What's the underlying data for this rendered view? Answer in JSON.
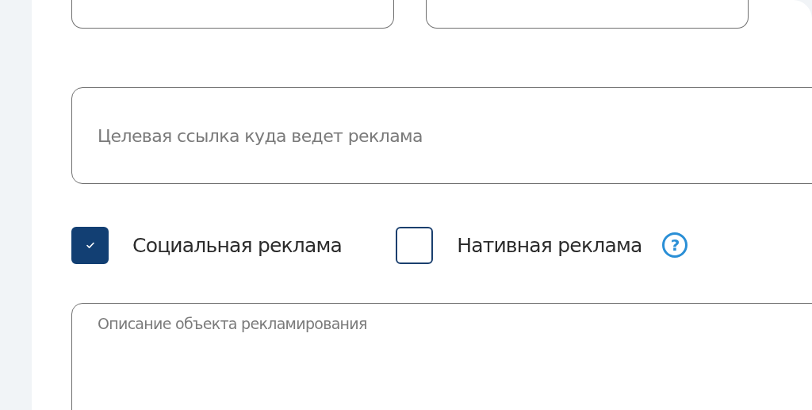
{
  "top_fields": [
    {
      "kind": "text"
    },
    {
      "kind": "text"
    }
  ],
  "link_field": {
    "placeholder": "Целевая ссылка куда ведет реклама"
  },
  "checkboxes": [
    {
      "label": "Социальная реклама",
      "checked": true
    },
    {
      "label": "Нативная реклама",
      "checked": false,
      "help": "?"
    }
  ],
  "description_field": {
    "placeholder": "Описание объекта рекламирования"
  }
}
